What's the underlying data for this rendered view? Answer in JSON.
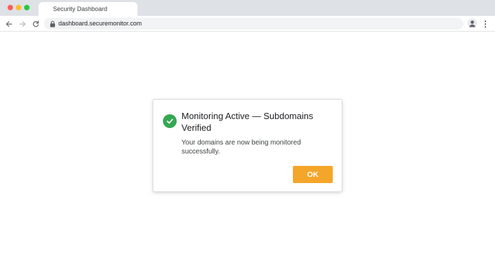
{
  "browser": {
    "tab": {
      "title": "Security Dashboard"
    },
    "address_bar": {
      "url": "dashboard.securemonitor.com"
    },
    "icons": {
      "back": "arrow-left-icon",
      "forward": "arrow-right-icon",
      "reload": "reload-icon",
      "lock": "lock-icon",
      "profile": "account-icon",
      "menu": "more-vert-icon"
    }
  },
  "dialog": {
    "icon": "check-circle-icon",
    "title": "Monitoring Active — Subdomains Verified",
    "message": "Your domains are now being monitored successfully.",
    "ok_label": "OK"
  },
  "colors": {
    "accent_button": "#f4a62a",
    "success": "#34a853",
    "traffic_red": "#ff5f57",
    "traffic_yellow": "#febc2e",
    "traffic_green": "#28c840"
  }
}
